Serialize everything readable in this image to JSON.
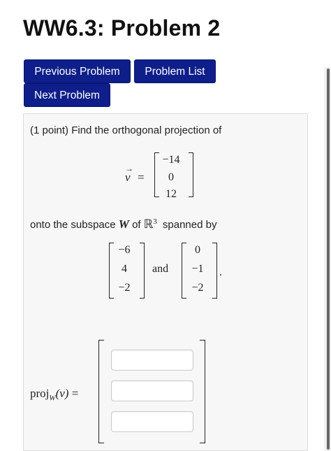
{
  "page": {
    "title": "WW6.3: Problem 2"
  },
  "nav": {
    "previous_label": "Previous Problem",
    "list_label": "Problem List",
    "next_label": "Next Problem"
  },
  "problem": {
    "intro": "(1 point) Find the orthogonal projection of",
    "v_label": "v",
    "v_arrow": "→",
    "equals": "=",
    "v_values": [
      "−14",
      "0",
      "12"
    ],
    "onto_prefix": "onto the subspace",
    "W": "W",
    "of": "of",
    "R": "ℝ",
    "R_exp": "3",
    "spanned_by": "spanned by",
    "u1": [
      "−6",
      "4",
      "−2"
    ],
    "and": "and",
    "u2": [
      "0",
      "−1",
      "−2"
    ],
    "period": ".",
    "proj_label": "proj",
    "proj_sub": "W",
    "proj_arg": "(v)",
    "answer_values": [
      "",
      "",
      ""
    ]
  },
  "colors": {
    "button_bg": "#0e1e8a",
    "panel_bg": "#f7f7f7"
  }
}
